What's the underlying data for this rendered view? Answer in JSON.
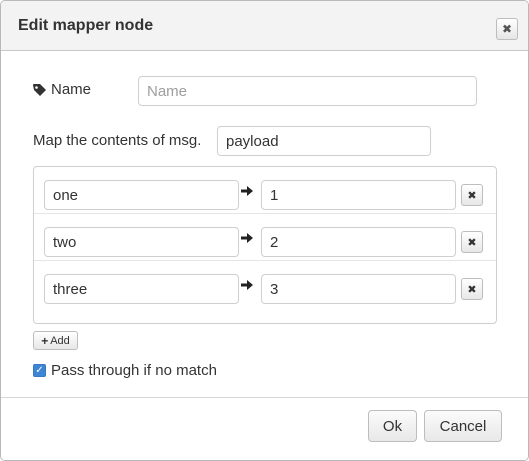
{
  "dialog": {
    "title": "Edit mapper node"
  },
  "name_field": {
    "label": "Name",
    "value": "",
    "placeholder": "Name"
  },
  "map": {
    "label": "Map the contents of msg.",
    "property": "payload"
  },
  "rules": [
    {
      "from": "one",
      "to": "1"
    },
    {
      "from": "two",
      "to": "2"
    },
    {
      "from": "three",
      "to": "3"
    }
  ],
  "add_button": {
    "label": "Add"
  },
  "pass_through": {
    "label": "Pass through if no match",
    "checked": true
  },
  "footer": {
    "ok_label": "Ok",
    "cancel_label": "Cancel"
  },
  "icons": {
    "close": "close-icon",
    "tag": "tag-icon",
    "arrow": "arrow-right-icon",
    "delete": "close-icon",
    "plus": "plus-icon",
    "check": "check-icon"
  },
  "colors": {
    "checkbox": "#3d86d6"
  }
}
